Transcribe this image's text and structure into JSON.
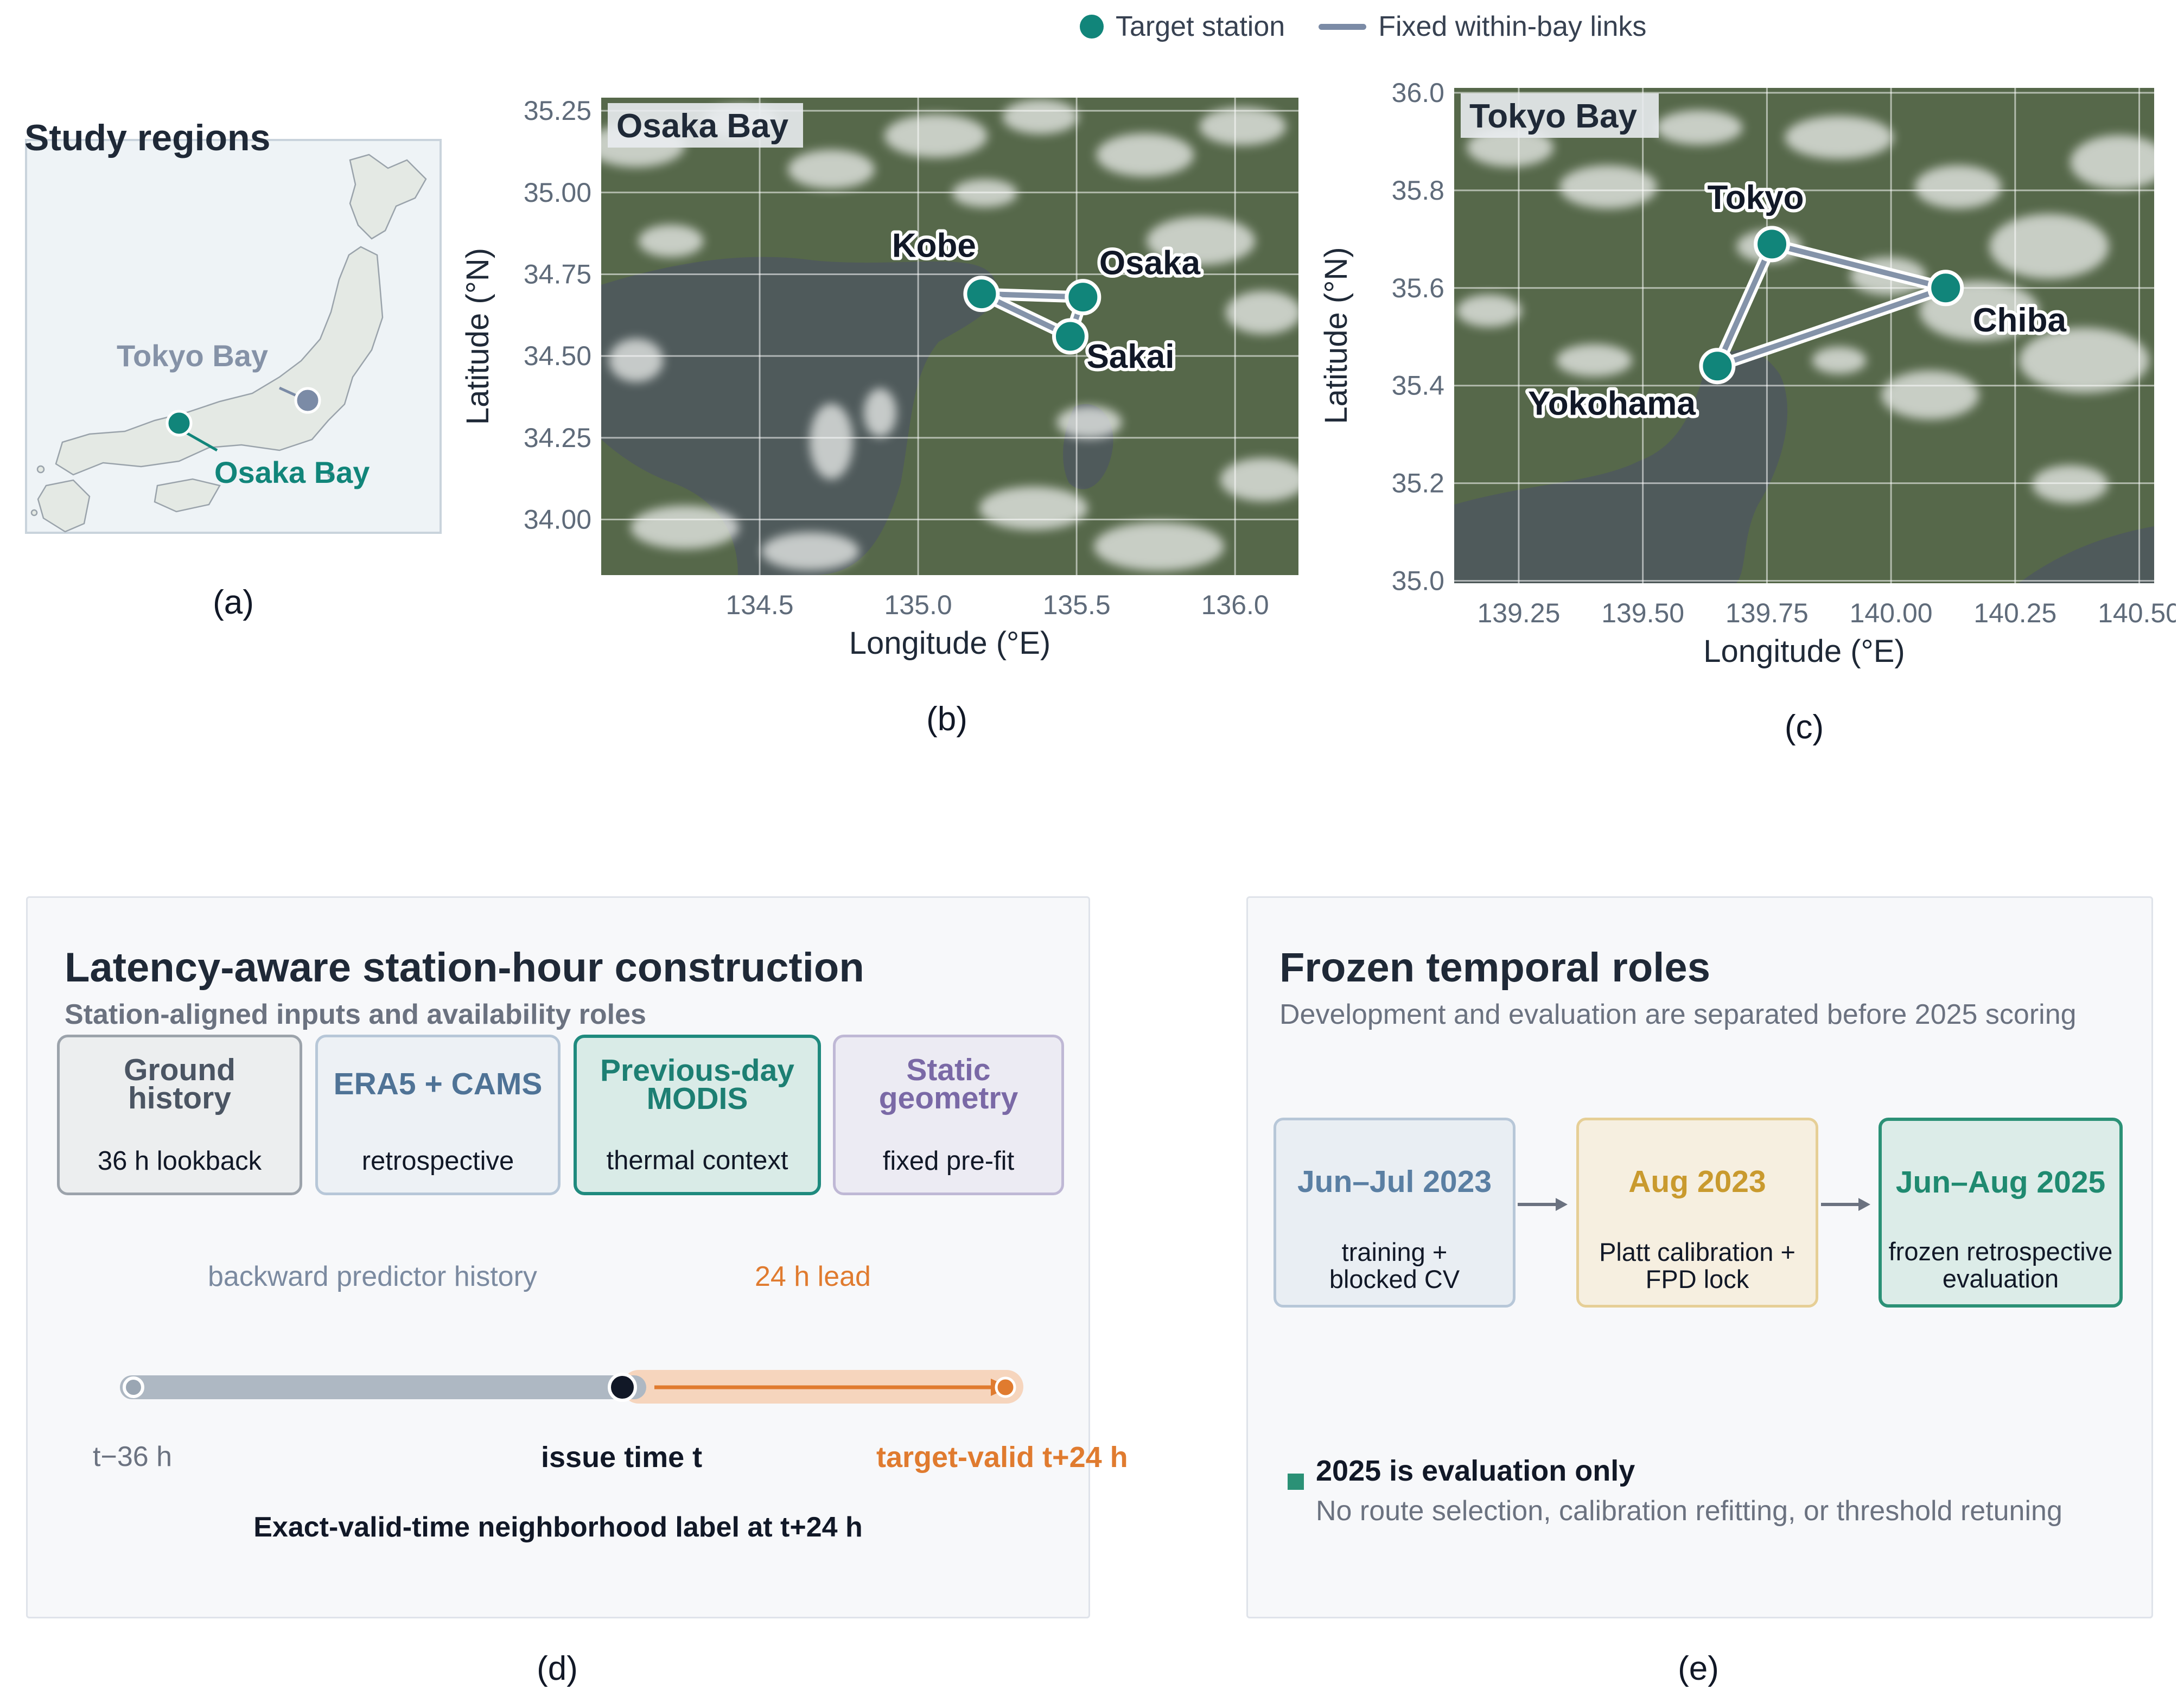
{
  "legend": {
    "station_label": "Target station",
    "links_label": "Fixed within-bay links"
  },
  "captions": {
    "a": "(a)",
    "b": "(b)",
    "c": "(c)",
    "d": "(d)",
    "e": "(e)"
  },
  "panel_a": {
    "title": "Study regions",
    "tokyo_label": "Tokyo Bay",
    "osaka_label": "Osaka Bay"
  },
  "panel_b": {
    "inset_title": "Osaka Bay",
    "xlabel": "Longitude (°E)",
    "ylabel": "Latitude (°N)",
    "xticks": [
      "134.5",
      "135.0",
      "135.5",
      "136.0"
    ],
    "yticks": [
      "35.25",
      "35.00",
      "34.75",
      "34.50",
      "34.25",
      "34.00"
    ],
    "xlim": [
      134.0,
      136.2
    ],
    "ylim": [
      33.83,
      35.29
    ],
    "stations": [
      {
        "name": "Kobe",
        "lon": 135.2,
        "lat": 34.69
      },
      {
        "name": "Osaka",
        "lon": 135.52,
        "lat": 34.68
      },
      {
        "name": "Sakai",
        "lon": 135.48,
        "lat": 34.56
      }
    ]
  },
  "panel_c": {
    "inset_title": "Tokyo Bay",
    "xlabel": "Longitude (°E)",
    "ylabel": "Latitude (°N)",
    "xticks": [
      "139.25",
      "139.50",
      "139.75",
      "140.00",
      "140.25",
      "140.50"
    ],
    "yticks": [
      "36.0",
      "35.8",
      "35.6",
      "35.4",
      "35.2",
      "35.0"
    ],
    "xlim": [
      139.12,
      140.53
    ],
    "ylim": [
      34.995,
      36.01
    ],
    "stations": [
      {
        "name": "Tokyo",
        "lon": 139.76,
        "lat": 35.69
      },
      {
        "name": "Chiba",
        "lon": 140.11,
        "lat": 35.6
      },
      {
        "name": "Yokohama",
        "lon": 139.65,
        "lat": 35.44
      }
    ]
  },
  "chart_data": [
    {
      "type": "scatter",
      "title": "Osaka Bay",
      "xlabel": "Longitude (°E)",
      "ylabel": "Latitude (°N)",
      "xlim": [
        134.0,
        136.2
      ],
      "ylim": [
        33.83,
        35.29
      ],
      "points": [
        {
          "label": "Kobe",
          "x": 135.2,
          "y": 34.69
        },
        {
          "label": "Osaka",
          "x": 135.52,
          "y": 34.68
        },
        {
          "label": "Sakai",
          "x": 135.48,
          "y": 34.56
        }
      ]
    },
    {
      "type": "scatter",
      "title": "Tokyo Bay",
      "xlabel": "Longitude (°E)",
      "ylabel": "Latitude (°N)",
      "xlim": [
        139.12,
        140.53
      ],
      "ylim": [
        34.995,
        36.01
      ],
      "points": [
        {
          "label": "Tokyo",
          "x": 139.76,
          "y": 35.69
        },
        {
          "label": "Chiba",
          "x": 140.11,
          "y": 35.6
        },
        {
          "label": "Yokohama",
          "x": 139.65,
          "y": 35.44
        }
      ]
    }
  ],
  "panel_d": {
    "title": "Latency-aware station-hour construction",
    "subtitle": "Station-aligned inputs and availability roles",
    "cards": [
      {
        "title_line1": "Ground",
        "title_line2": "history",
        "desc": "36 h lookback",
        "color": "#4b5563"
      },
      {
        "title_line1": "ERA5 + CAMS",
        "title_line2": "",
        "desc": "retrospective",
        "color": "#4f7396"
      },
      {
        "title_line1": "Previous-day",
        "title_line2": "MODIS",
        "desc": "thermal context",
        "color": "#1d7f73"
      },
      {
        "title_line1": "Static",
        "title_line2": "geometry",
        "desc": "fixed pre-fit",
        "color": "#7a69a6"
      }
    ],
    "history_label": "backward predictor history",
    "lead_label": "24 h lead",
    "t_start": "t−36 h",
    "t_issue": "issue time t",
    "t_target": "target-valid t+24 h",
    "footer": "Exact-valid-time neighborhood label at t+24 h"
  },
  "panel_e": {
    "title": "Frozen temporal roles",
    "subtitle": "Development and evaluation are separated before 2025 scoring",
    "periods": [
      {
        "label": "Jun–Jul 2023",
        "desc_line1": "training +",
        "desc_line2": "blocked CV",
        "color": "#5a7fa3"
      },
      {
        "label": "Aug 2023",
        "desc_line1": "Platt calibration +",
        "desc_line2": "FPD lock",
        "color": "#c99a2e"
      },
      {
        "label": "Jun–Aug 2025",
        "desc_line1": "frozen retrospective",
        "desc_line2": "evaluation",
        "color": "#1f8a70"
      }
    ],
    "note_title": "2025 is evaluation only",
    "note_text": "No route selection, calibration refitting, or threshold retuning"
  }
}
